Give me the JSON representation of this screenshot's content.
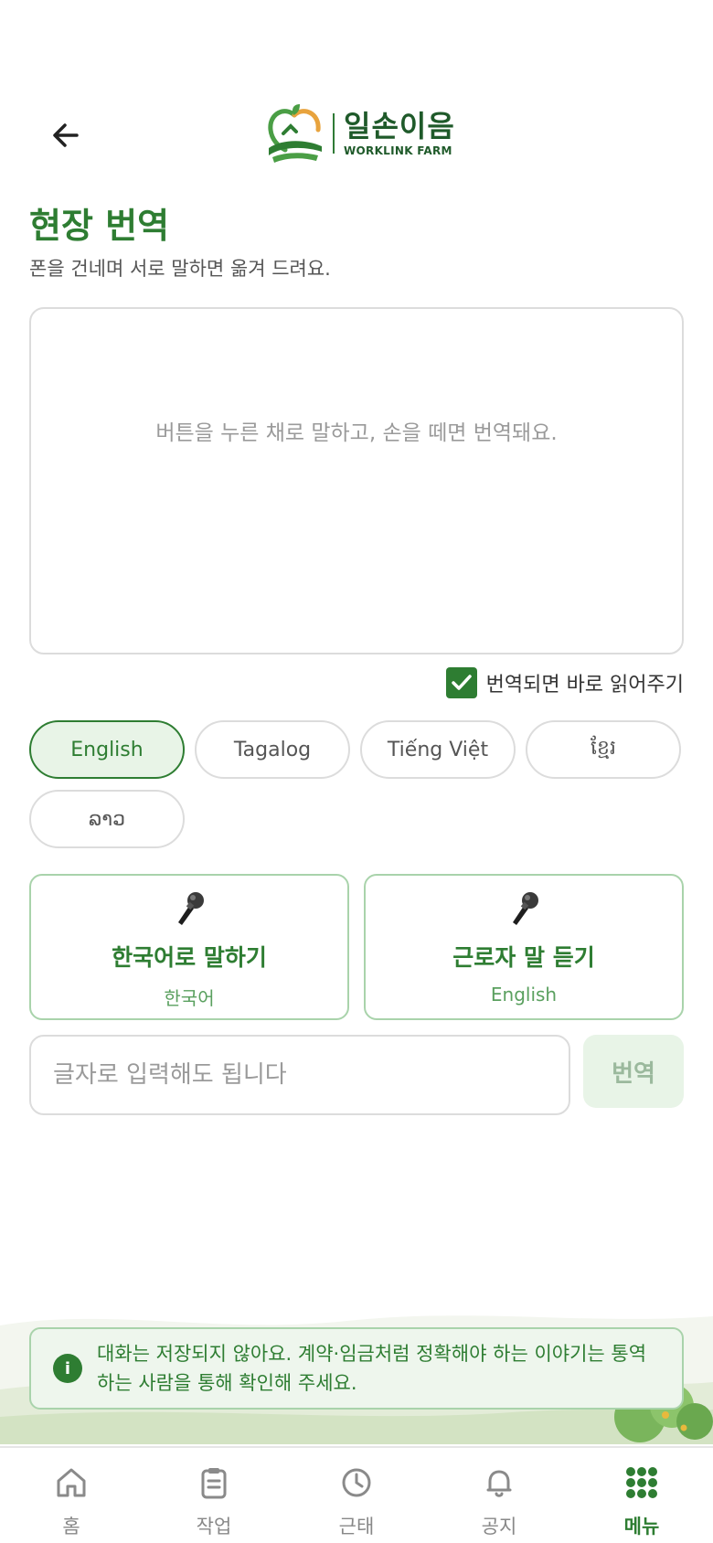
{
  "header": {
    "back_icon": "arrow-left-icon",
    "logo_ko": "일손이음",
    "logo_en": "WORKLINK FARM"
  },
  "page": {
    "title": "현장 번역",
    "subtitle": "폰을 건네며 서로 말하면 옮겨 드려요."
  },
  "transcript": {
    "hint": "버튼을 누른 채로 말하고, 손을 떼면 번역돼요."
  },
  "auto_read": {
    "checked": true,
    "label": "번역되면 바로 읽어주기"
  },
  "languages": [
    {
      "label": "English",
      "active": true
    },
    {
      "label": "Tagalog",
      "active": false
    },
    {
      "label": "Tiếng Việt",
      "active": false
    },
    {
      "label": "ខ្មែរ",
      "active": false
    },
    {
      "label": "ລາວ",
      "active": false
    }
  ],
  "modes": [
    {
      "icon": "microphone-icon",
      "title": "한국어로 말하기",
      "language": "한국어"
    },
    {
      "icon": "microphone-icon",
      "title": "근로자 말 듣기",
      "language": "English"
    }
  ],
  "text_input": {
    "value": "",
    "placeholder": "글자로 입력해도 됩니다",
    "button_label": "번역"
  },
  "notice": {
    "icon": "info-icon",
    "icon_text": "i",
    "text": "대화는 저장되지 않아요. 계약·임금처럼 정확해야 하는 이야기는 통역하는 사람을 통해 확인해 주세요."
  },
  "nav": [
    {
      "icon": "home-icon",
      "label": "홈",
      "active": false
    },
    {
      "icon": "clipboard-icon",
      "label": "작업",
      "active": false
    },
    {
      "icon": "clock-icon",
      "label": "근태",
      "active": false
    },
    {
      "icon": "bell-icon",
      "label": "공지",
      "active": false
    },
    {
      "icon": "grid-menu-icon",
      "label": "메뉴",
      "active": true
    }
  ],
  "colors": {
    "accent": "#2e7d32",
    "accent_light": "#e8f4e7",
    "border": "#dcdcdc",
    "logo_orange": "#e8a33d"
  }
}
